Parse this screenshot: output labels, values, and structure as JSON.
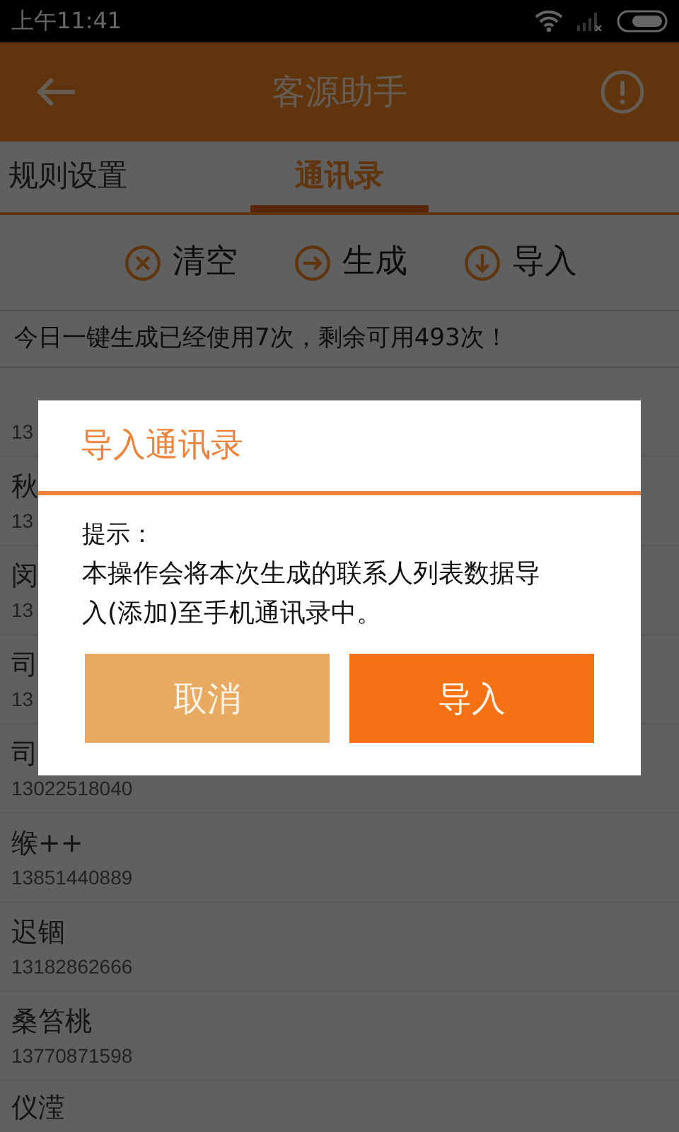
{
  "status_bar": {
    "time": "上午11:41"
  },
  "header": {
    "title": "客源助手"
  },
  "tabs": [
    {
      "label": "规则设置",
      "selected": false
    },
    {
      "label": "通讯录",
      "selected": true
    }
  ],
  "actions": [
    {
      "label": "清空",
      "kind": "clear"
    },
    {
      "label": "生成",
      "kind": "generate"
    },
    {
      "label": "导入",
      "kind": "import"
    }
  ],
  "notice": "今日一键生成已经使用7次，剩余可用493次！",
  "contacts": [
    {
      "phone": "13"
    },
    {
      "name": "秋",
      "phone": "13"
    },
    {
      "name": "闵",
      "phone": "13"
    },
    {
      "name": "司",
      "phone": "13"
    },
    {
      "name": "司",
      "phone": "13022518040"
    },
    {
      "name": "缑++",
      "phone": "13851440889"
    },
    {
      "name": "迟锢",
      "phone": "13182862666"
    },
    {
      "name": "桑笞桃",
      "phone": "13770871598"
    },
    {
      "name": "仪滢"
    }
  ],
  "dialog": {
    "title": "导入通讯录",
    "label": "提示：",
    "message": "本操作会将本次生成的联系人列表数据导入(添加)至手机通讯录中。",
    "buttons": [
      {
        "label": "取消",
        "kind": "secondary"
      },
      {
        "label": "导入",
        "kind": "primary"
      }
    ]
  }
}
